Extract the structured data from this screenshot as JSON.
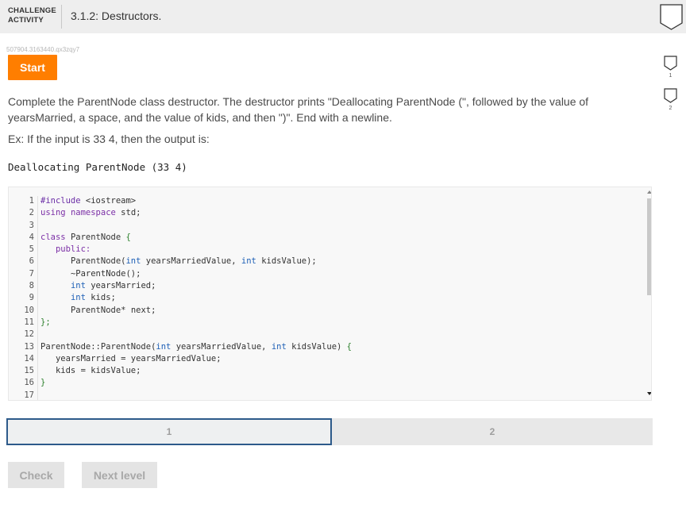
{
  "header": {
    "label_line1": "CHALLENGE",
    "label_line2": "ACTIVITY",
    "title": "3.1.2: Destructors."
  },
  "side_badges": [
    "1",
    "2"
  ],
  "activity_id": "507904.3163440.qx3zqy7",
  "start_label": "Start",
  "instructions": {
    "description": "Complete the ParentNode class destructor. The destructor prints \"Deallocating ParentNode (\", followed by the value of yearsMarried, a space, and the value of kids, and then \")\". End with a newline.",
    "example": "Ex: If the input is 33 4, then the output is:",
    "sample_output": "Deallocating ParentNode (33 4)"
  },
  "code": {
    "line_numbers": [
      "1",
      "2",
      "3",
      "4",
      "5",
      "6",
      "7",
      "8",
      "9",
      "10",
      "11",
      "12",
      "13",
      "14",
      "15",
      "16",
      "17"
    ],
    "lines": [
      [
        "#include <iostream>"
      ],
      [
        "using namespace std;"
      ],
      [
        ""
      ],
      [
        "class ParentNode {"
      ],
      [
        "   public:"
      ],
      [
        "      ParentNode(int yearsMarriedValue, int kidsValue);"
      ],
      [
        "      ~ParentNode();"
      ],
      [
        "      int yearsMarried;"
      ],
      [
        "      int kids;"
      ],
      [
        "      ParentNode* next;"
      ],
      [
        "};"
      ],
      [
        ""
      ],
      [
        "ParentNode::ParentNode(int yearsMarriedValue, int kidsValue) {"
      ],
      [
        "   yearsMarried = yearsMarriedValue;"
      ],
      [
        "   kids = kidsValue;"
      ],
      [
        "}"
      ],
      [
        ""
      ]
    ],
    "tokens": {
      "include": "#include",
      "iostream": "<iostream>",
      "using": "using",
      "namespace": "namespace",
      "std": "std;",
      "class": "class",
      "parentnode": "ParentNode",
      "brace_open": "{",
      "public": "public:",
      "ctor_decl": "ParentNode(",
      "int": "int",
      "ctor_param1": "yearsMarriedValue,",
      "ctor_param2": "kidsValue);",
      "dtor_decl": "~ParentNode();",
      "member1": "yearsMarried;",
      "member2": "kids;",
      "ptr": "ParentNode*",
      "member3": "next;",
      "close_class": "};",
      "ctor_def": "ParentNode::ParentNode(",
      "def_param1": "yearsMarriedValue,",
      "def_param2": "kidsValue)",
      "assign1": "yearsMarried = yearsMarriedValue;",
      "assign2": "kids = kidsValue;",
      "brace_close": "}"
    }
  },
  "levels": [
    "1",
    "2"
  ],
  "buttons": {
    "check": "Check",
    "next_level": "Next level"
  }
}
